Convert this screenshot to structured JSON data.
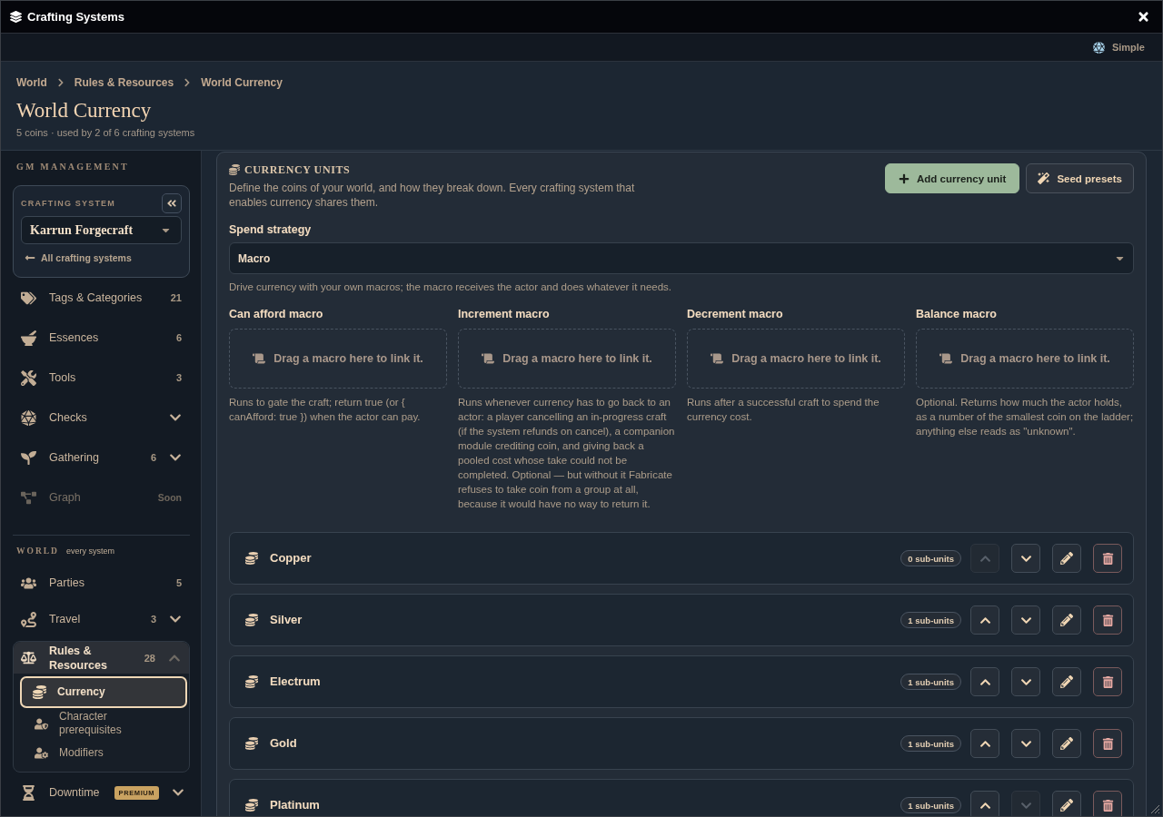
{
  "window": {
    "title": "Crafting Systems"
  },
  "toolbar": {
    "mode": "Simple"
  },
  "breadcrumbs": [
    {
      "label": "World"
    },
    {
      "label": "Rules & Resources"
    },
    {
      "label": "World Currency"
    }
  ],
  "header": {
    "title": "World Currency",
    "subtitle": "5 coins · used by 2 of 6 crafting systems"
  },
  "sidebar": {
    "section_title": "GM MANAGEMENT",
    "crafting_system": {
      "label": "CRAFTING SYSTEM",
      "value": "Karrun Forgecraft",
      "back_link": "All crafting systems"
    },
    "items": [
      {
        "kind": "link",
        "label": "Tags & Categories",
        "count": "21",
        "disabled": false
      },
      {
        "kind": "link",
        "label": "Essences",
        "count": "6",
        "disabled": false
      },
      {
        "kind": "link",
        "label": "Tools",
        "count": "3",
        "disabled": false
      },
      {
        "kind": "group",
        "label": "Checks",
        "expanded": false,
        "disabled": false
      },
      {
        "kind": "group",
        "label": "Gathering",
        "count": "6",
        "expanded": false,
        "disabled": false
      },
      {
        "kind": "link",
        "label": "Graph",
        "tag": "Soon",
        "disabled": true
      }
    ],
    "world": {
      "title": "WORLD",
      "hint": "every system",
      "items": [
        {
          "kind": "link",
          "label": "Parties",
          "count": "5"
        },
        {
          "kind": "group",
          "label": "Travel",
          "count": "3",
          "expanded": false
        },
        {
          "kind": "group",
          "label": "Rules & Resources",
          "count": "28",
          "expanded": true,
          "children": [
            {
              "label": "Currency",
              "selected": true
            },
            {
              "label": "Character prerequisites",
              "selected": false
            },
            {
              "label": "Modifiers",
              "selected": false
            }
          ]
        },
        {
          "kind": "group",
          "label": "Downtime",
          "badge": "PREMIUM",
          "expanded": false
        }
      ]
    }
  },
  "currency_units": {
    "title": "CURRENCY UNITS",
    "description": "Define the coins of your world, and how they break down. Every crafting system that enables currency shares them.",
    "buttons": [
      {
        "kind": "primary",
        "label": "Add currency unit"
      },
      {
        "kind": "secondary",
        "label": "Seed presets"
      }
    ],
    "spend_strategy": {
      "label": "Spend strategy",
      "value": "Macro",
      "help": "Drive currency with your own macros; the macro receives the actor and does whatever it needs."
    },
    "macros": [
      {
        "label": "Can afford macro",
        "placeholder": "Drag a macro here to link it.",
        "description": "Runs to gate the craft; return true (or { canAfford: true }) when the actor can pay."
      },
      {
        "label": "Increment macro",
        "placeholder": "Drag a macro here to link it.",
        "description": "Runs whenever currency has to go back to an actor: a player cancelling an in-progress craft (if the system refunds on cancel), a companion module crediting coin, and giving back a pooled cost whose take could not be completed. Optional — but without it Fabricate refuses to take coin from a group at all, because it would have no way to return it."
      },
      {
        "label": "Decrement macro",
        "placeholder": "Drag a macro here to link it.",
        "description": "Runs after a successful craft to spend the currency cost."
      },
      {
        "label": "Balance macro",
        "placeholder": "Drag a macro here to link it.",
        "description": "Optional. Returns how much the actor holds, as a number of the smallest coin on the ladder; anything else reads as \"unknown\"."
      }
    ],
    "units": [
      {
        "name": "Copper",
        "sub_units": "0 sub-units",
        "up_disabled": true,
        "down_disabled": false
      },
      {
        "name": "Silver",
        "sub_units": "1 sub-units",
        "up_disabled": false,
        "down_disabled": false
      },
      {
        "name": "Electrum",
        "sub_units": "1 sub-units",
        "up_disabled": false,
        "down_disabled": false
      },
      {
        "name": "Gold",
        "sub_units": "1 sub-units",
        "up_disabled": false,
        "down_disabled": false
      },
      {
        "name": "Platinum",
        "sub_units": "1 sub-units",
        "up_disabled": false,
        "down_disabled": true
      }
    ]
  }
}
